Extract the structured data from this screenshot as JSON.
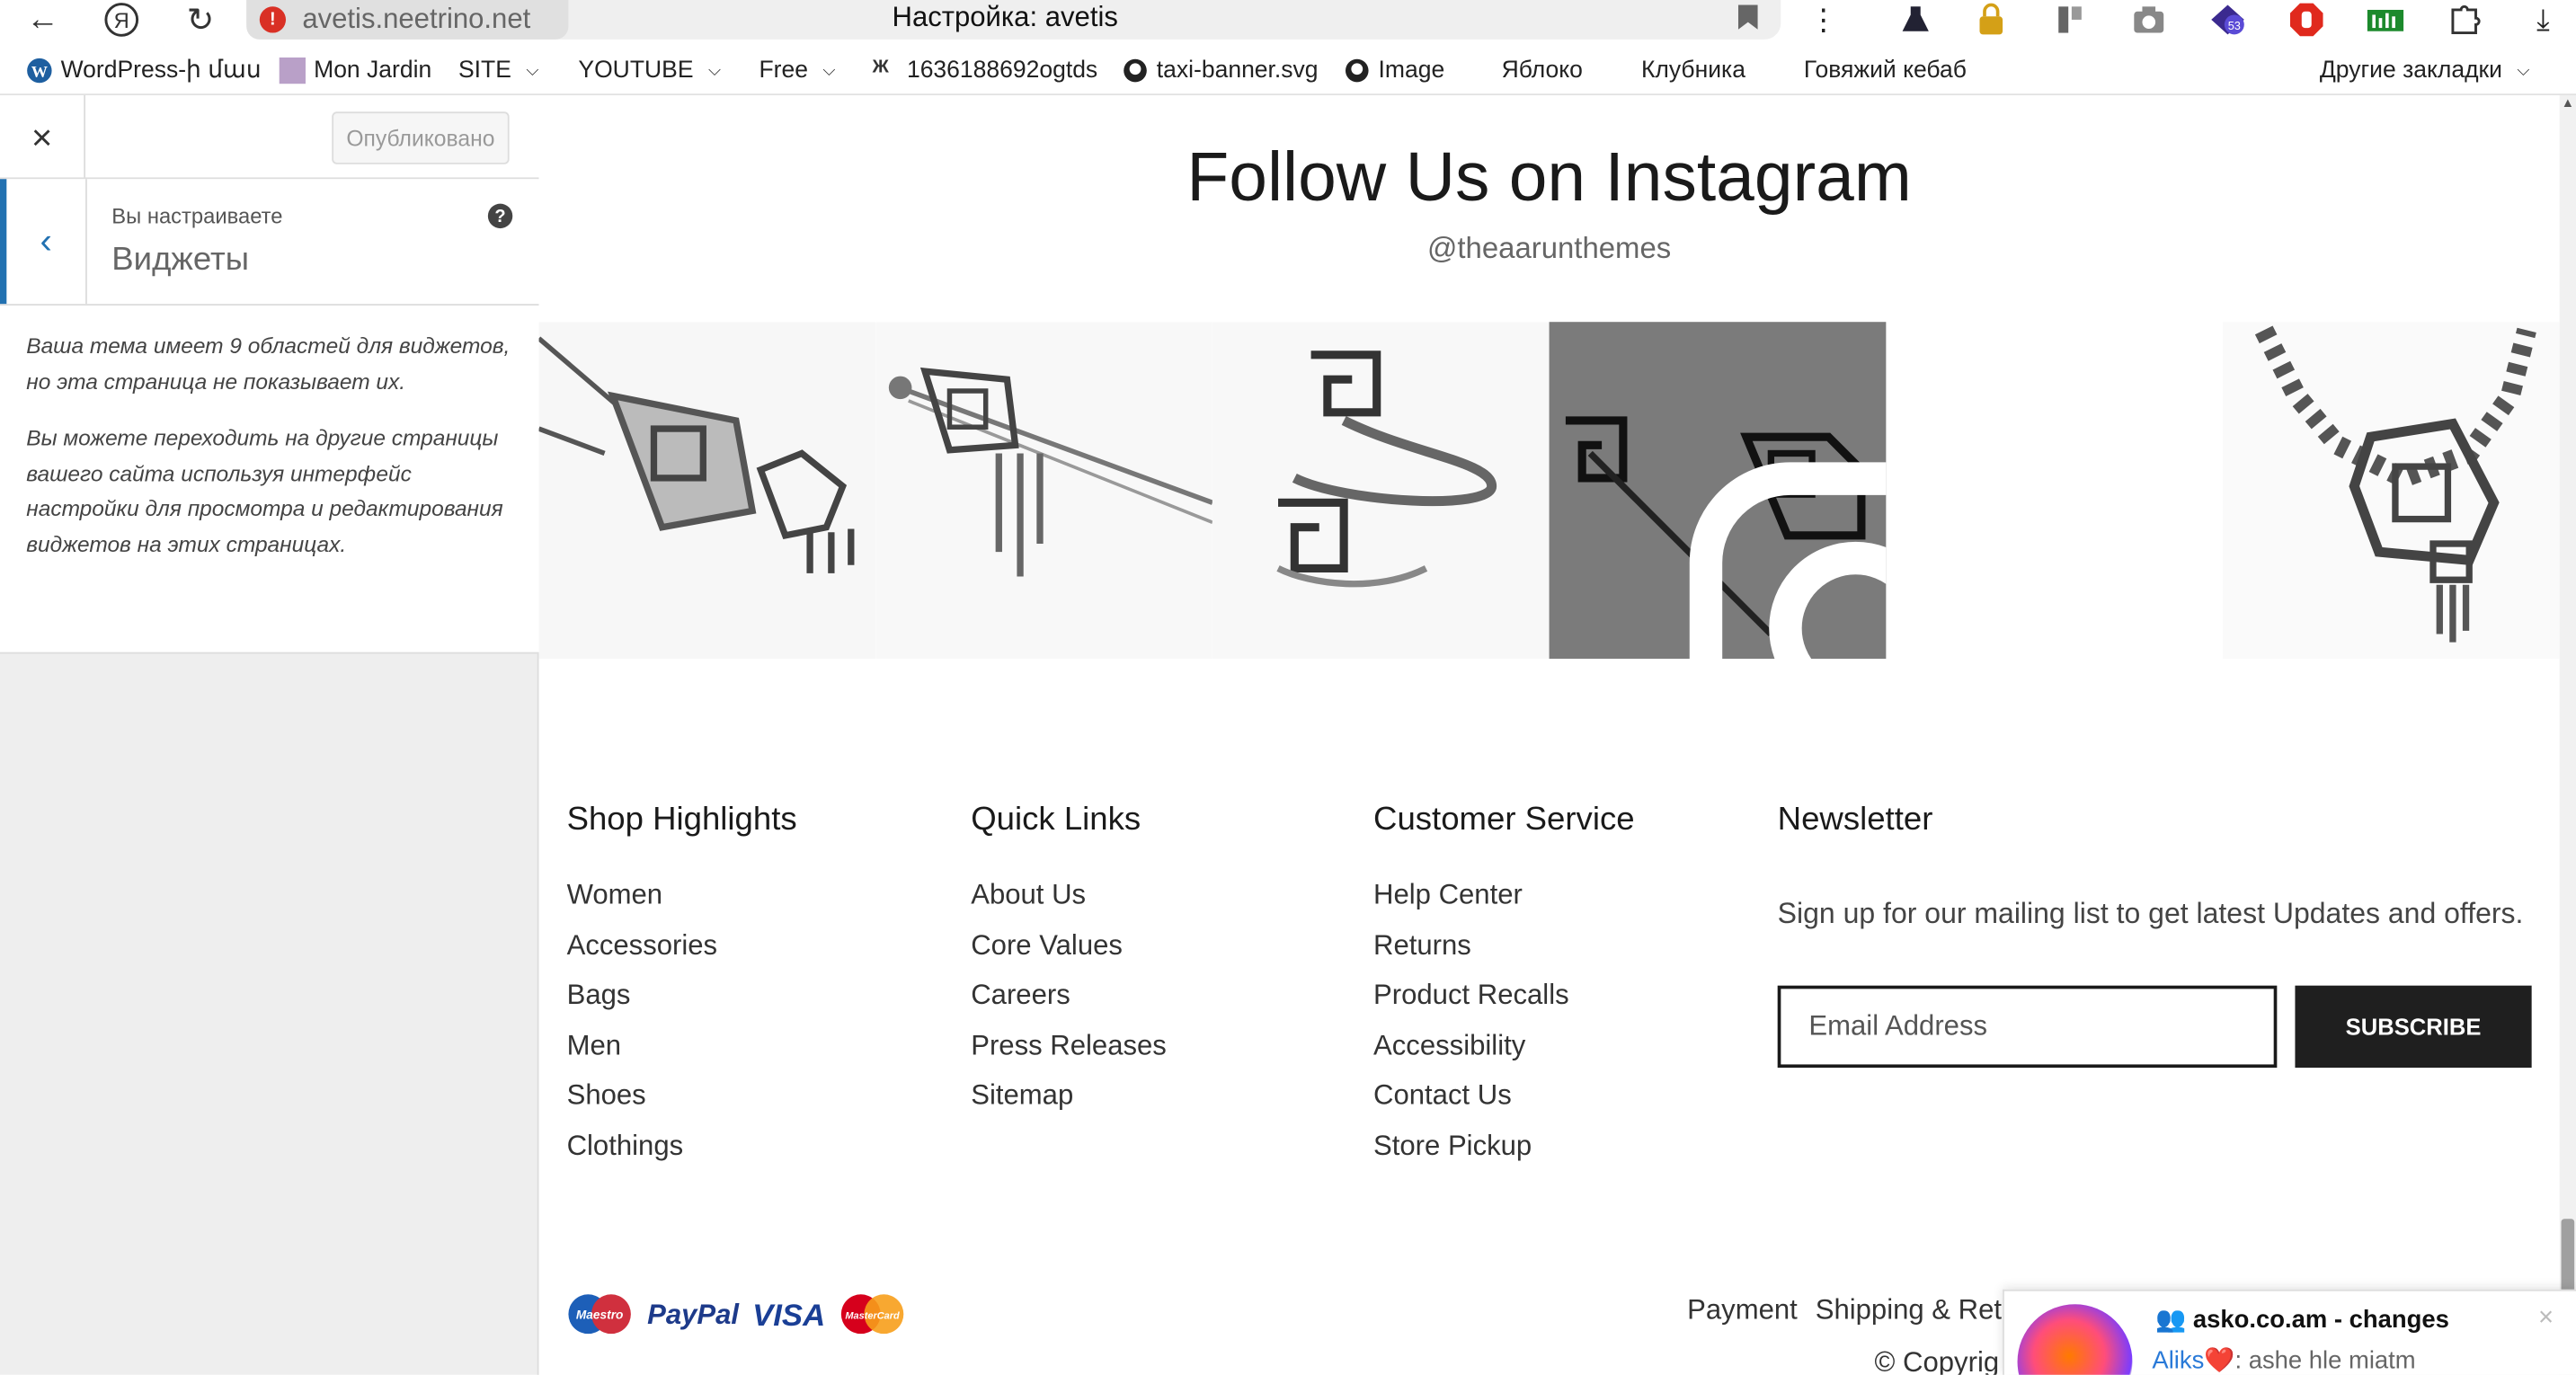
{
  "browser": {
    "host": "avetis.neetrino.net",
    "page_title": "Настройка: avetis",
    "icons": [
      "back-arrow-icon",
      "yandex-icon",
      "reload-icon",
      "security-warning-icon",
      "bookmark-icon",
      "menu-dots-icon",
      "extension-icons",
      "download-icon"
    ]
  },
  "bookmarks": [
    {
      "label": "WordPress-ի մաս",
      "icon": "wordpress-icon",
      "dropdown": false
    },
    {
      "label": "Mon Jardin",
      "icon": "folder-icon",
      "dropdown": false
    },
    {
      "label": "SITE",
      "icon": "",
      "dropdown": true
    },
    {
      "label": "YOUTUBE",
      "icon": "",
      "dropdown": true
    },
    {
      "label": "Free",
      "icon": "",
      "dropdown": true
    },
    {
      "label": "1636188692ogtds",
      "icon": "page-icon",
      "dropdown": false
    },
    {
      "label": "taxi-banner.svg",
      "icon": "github-icon",
      "dropdown": false
    },
    {
      "label": "Image",
      "icon": "github-icon",
      "dropdown": false
    },
    {
      "label": "Яблоко",
      "icon": "",
      "dropdown": false
    },
    {
      "label": "Клубника",
      "icon": "",
      "dropdown": false
    },
    {
      "label": "Говяжий кебаб",
      "icon": "",
      "dropdown": false
    },
    {
      "label": "Другие закладки",
      "icon": "",
      "dropdown": true
    }
  ],
  "customizer": {
    "close_label": "×",
    "publish_label": "Опубликовано",
    "customizing_label": "Вы настраиваете",
    "section_title": "Виджеты",
    "help_label": "?",
    "description": [
      "Ваша тема имеет 9 областей для виджетов, но эта страница не показывает их.",
      "Вы можете переходить на другие страницы вашего сайта используя интерфейс настройки для просмотра и редактирования виджетов на этих страницах."
    ]
  },
  "instagram": {
    "title": "Follow Us on Instagram",
    "handle": "@theaarunthemes"
  },
  "footer": {
    "columns": [
      {
        "heading": "Shop Highlights",
        "links": [
          "Women",
          "Accessories",
          "Bags",
          "Men",
          "Shoes",
          "Clothings"
        ]
      },
      {
        "heading": "Quick Links",
        "links": [
          "About Us",
          "Core Values",
          "Careers",
          "Press Releases",
          "Sitemap"
        ]
      },
      {
        "heading": "Customer Service",
        "links": [
          "Help Center",
          "Returns",
          "Product Recalls",
          "Accessibility",
          "Contact Us",
          "Store Pickup"
        ]
      }
    ],
    "newsletter": {
      "heading": "Newsletter",
      "text": "Sign up for our mailing list to get latest Updates and offers.",
      "placeholder": "Email Address",
      "button": "SUBSCRIBE"
    },
    "payment_logos": [
      "Maestro",
      "PayPal",
      "VISA",
      "MasterCard"
    ],
    "bottom_links": [
      "Payment",
      "Shipping & Ret"
    ],
    "copyright": "© Copyrig"
  },
  "notification": {
    "title": "asko.co.am - changes",
    "sender": "Aliks",
    "message": ": ashe hle miatm",
    "close": "×"
  },
  "colors": {
    "accent": "#2271b1",
    "button_dark": "#1f1f1f",
    "warning": "#d93025"
  }
}
